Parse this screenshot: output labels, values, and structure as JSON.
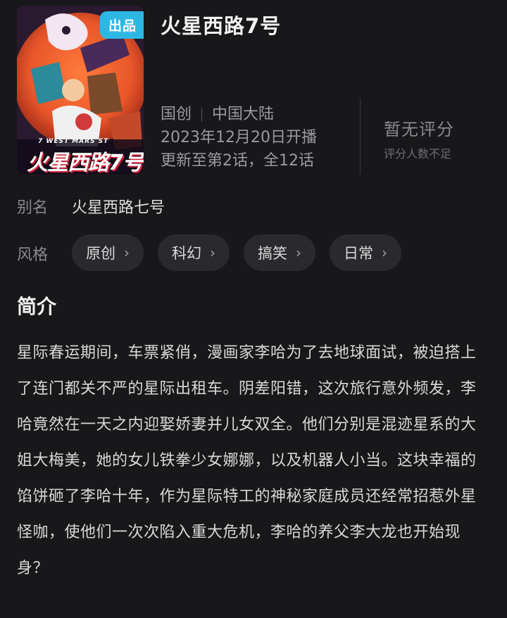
{
  "show": {
    "title": "火星西路7号",
    "badge": "出品",
    "poster_logo": "火星西路7号",
    "poster_subtitle": "7 WEST MARS ST"
  },
  "meta": {
    "origin_type": "国创",
    "region": "中国大陆",
    "air_date": "2023年12月20日开播",
    "episodes": "更新至第2话，全12话"
  },
  "rating": {
    "main": "暂无评分",
    "sub": "评分人数不足"
  },
  "alias": {
    "label": "别名",
    "value": "火星西路七号"
  },
  "genre": {
    "label": "风格",
    "tags": [
      "原创",
      "科幻",
      "搞笑",
      "日常"
    ]
  },
  "synopsis": {
    "heading": "简介",
    "text": "星际春运期间，车票紧俏，漫画家李哈为了去地球面试，被迫搭上了连门都关不严的星际出租车。阴差阳错，这次旅行意外频发，李哈竟然在一天之内迎娶娇妻并儿女双全。他们分别是混迹星系的大姐大梅美，她的女儿铁拳少女娜娜，以及机器人小当。这块幸福的馅饼砸了李哈十年，作为星际特工的神秘家庭成员还经常招惹外星怪咖，使他们一次次陷入重大危机，李哈的养父李大龙也开始现身？"
  },
  "colors": {
    "background": "#18181a",
    "badge": "#2db8e3",
    "chip": "#2a2a2e",
    "poster_planet": "#e8562a"
  }
}
